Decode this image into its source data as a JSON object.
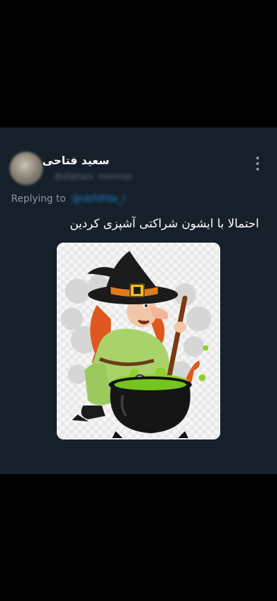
{
  "tweet": {
    "author_name": "سعید فتاحی",
    "author_handle": "@sfattahi_mmrnsh",
    "replying_to_label": "Replying to",
    "replying_to_handle": "@sbfdfda_l",
    "text": "احتمالا با ایشون شراکتی آشپزی کردین",
    "image_alt": "witch stirring cauldron illustration"
  },
  "icons": {
    "menu": "more-vertical-icon"
  },
  "colors": {
    "background": "#000000",
    "card": "#16202b",
    "text": "#ffffff",
    "muted": "#8b98a5",
    "link": "#1d7bc4"
  }
}
